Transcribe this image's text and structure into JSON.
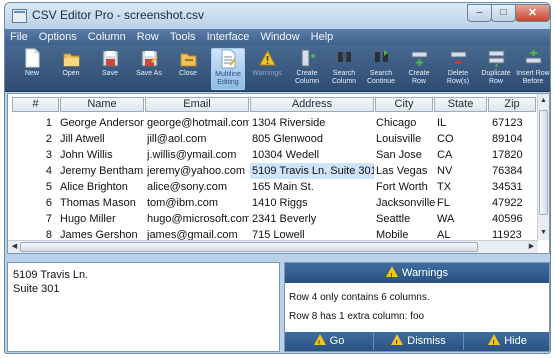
{
  "window": {
    "title": "CSV Editor Pro - screenshot.csv",
    "minimize": "–",
    "maximize": "□",
    "close": "✕"
  },
  "menu": [
    "File",
    "Options",
    "Column",
    "Row",
    "Tools",
    "Interface",
    "Window",
    "Help"
  ],
  "toolbar": [
    {
      "label": "New",
      "icon": "new-file-icon"
    },
    {
      "label": "Open",
      "icon": "open-folder-icon"
    },
    {
      "label": "Save",
      "icon": "save-icon"
    },
    {
      "label": "Save As",
      "icon": "save-as-icon"
    },
    {
      "label": "Close",
      "icon": "close-file-icon"
    },
    {
      "label": "Multiline Editing",
      "icon": "multiline-edit-icon",
      "state": "active"
    },
    {
      "label": "Warnings",
      "icon": "warning-icon",
      "state": "disabled"
    },
    {
      "label": "Create Column",
      "icon": "create-column-icon"
    },
    {
      "label": "Search Column",
      "icon": "search-column-icon"
    },
    {
      "label": "Search Continue",
      "icon": "search-continue-icon"
    },
    {
      "label": "Create Row",
      "icon": "create-row-icon"
    },
    {
      "label": "Delete Row(s)",
      "icon": "delete-row-icon"
    },
    {
      "label": "Duplicate Row",
      "icon": "duplicate-row-icon"
    },
    {
      "label": "Insert Row Before",
      "icon": "insert-row-icon"
    }
  ],
  "table": {
    "columns": [
      "#",
      "Name",
      "Email",
      "Address",
      "City",
      "State",
      "Zip"
    ],
    "rows": [
      [
        "1",
        "George Anderson",
        "george@hotmail.com",
        "1304 Riverside",
        "Chicago",
        "IL",
        "67123"
      ],
      [
        "2",
        "Jill Atwell",
        "jill@aol.com",
        "805 Glenwood",
        "Louisville",
        "CO",
        "89104"
      ],
      [
        "3",
        "John Willis",
        "j.willis@ymail.com",
        "10304 Wedell",
        "San Jose",
        "CA",
        "17820"
      ],
      [
        "4",
        "Jeremy Bentham",
        "jeremy@yahoo.com",
        "5109 Travis Ln. Suite 301",
        "Las Vegas",
        "NV",
        "76384"
      ],
      [
        "5",
        "Alice Brighton",
        "alice@sony.com",
        "165 Main St.",
        "Fort Worth",
        "TX",
        "34531"
      ],
      [
        "6",
        "Thomas Mason",
        "tom@ibm.com",
        "1410 Riggs",
        "Jacksonville",
        "FL",
        "47922"
      ],
      [
        "7",
        "Hugo Miller",
        "hugo@microsoft.com",
        "2341 Beverly",
        "Seattle",
        "WA",
        "40596"
      ],
      [
        "8",
        "James Gershon",
        "james@gmail.com",
        "715 Lowell",
        "Mobile",
        "AL",
        "11923"
      ]
    ],
    "selected_row": 4,
    "selected_column": "Address"
  },
  "detail": {
    "line1": "5109 Travis Ln.",
    "line2": "Suite 301"
  },
  "warnings": {
    "title": "Warnings",
    "messages": [
      "Row 4 only contains 6 columns.",
      "Row 8 has 1 extra column: foo"
    ],
    "buttons": {
      "go": "Go",
      "dismiss": "Dismiss",
      "hide": "Hide"
    }
  },
  "colors": {
    "accent": "#2a5283",
    "selection": "#cfe4fb",
    "warning": "#f2c41f"
  }
}
